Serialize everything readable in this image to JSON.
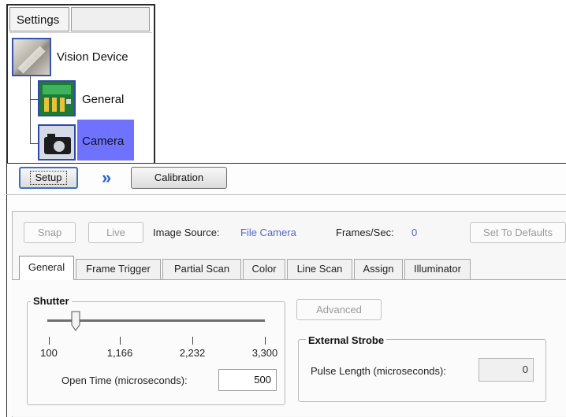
{
  "tree": {
    "tab_label": "Settings",
    "items": [
      {
        "label": "Vision Device",
        "icon": "vision-device-icon"
      },
      {
        "label": "General",
        "icon": "circuit-board-icon"
      },
      {
        "label": "Camera",
        "icon": "camera-icon",
        "selected": true
      }
    ]
  },
  "toolbar": {
    "setup_label": "Setup",
    "next_icon": "double-chevron-right-icon",
    "calibration_label": "Calibration"
  },
  "camera": {
    "snap_label": "Snap",
    "live_label": "Live",
    "image_source_label": "Image Source:",
    "image_source_value": "File Camera",
    "frames_label": "Frames/Sec:",
    "frames_value": "0",
    "set_defaults_label": "Set To Defaults"
  },
  "tabs": [
    {
      "label": "General",
      "active": true
    },
    {
      "label": "Frame Trigger"
    },
    {
      "label": "Partial Scan"
    },
    {
      "label": "Color"
    },
    {
      "label": "Line Scan"
    },
    {
      "label": "Assign"
    },
    {
      "label": "Illuminator"
    }
  ],
  "shutter": {
    "title": "Shutter",
    "ticks": [
      "100",
      "1,166",
      "2,232",
      "3,300"
    ],
    "slider_value": 500,
    "slider_min": 100,
    "slider_max": 3300,
    "open_time_label": "Open Time (microseconds):",
    "open_time_value": "500"
  },
  "strobe": {
    "advanced_label": "Advanced",
    "title": "External Strobe",
    "pulse_label": "Pulse Length (microseconds):",
    "pulse_value": "0"
  },
  "colors": {
    "selection": "#6f72ff",
    "link_blue": "#5566c8",
    "focus_blue": "#3a6fc4"
  }
}
